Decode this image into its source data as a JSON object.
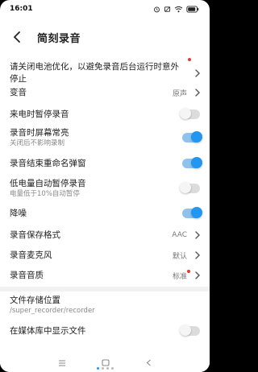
{
  "status_bar": {
    "time": "16:01"
  },
  "header": {
    "title": "简刻录音"
  },
  "settings": [
    {
      "label": "请关闭电池优化，以避免录音后台运行时意外停止"
    },
    {
      "label": "变音",
      "value": "原声"
    },
    {
      "label": "来电时暂停录音",
      "toggle": "off"
    },
    {
      "label": "录音时屏幕常亮",
      "sub": "关闭后不影响录制",
      "toggle": "on"
    },
    {
      "label": "录音结束重命名弹窗",
      "toggle": "on"
    },
    {
      "label": "低电量自动暂停录音",
      "sub": "电量低于10%自动暂停",
      "toggle": "off"
    },
    {
      "label": "降噪",
      "toggle": "on"
    },
    {
      "label": "录音保存格式",
      "value": "AAC"
    },
    {
      "label": "录音麦克风",
      "value": "默认"
    },
    {
      "label": "录音音质",
      "value": "标准"
    },
    {
      "label": "文件存储位置",
      "sub": "/super_recorder/recorder"
    },
    {
      "label": "在媒体库中显示文件",
      "toggle": "off"
    }
  ],
  "colors": {
    "accent": "#2196f3",
    "alert_dot": "#e53935"
  },
  "icons": [
    "back-arrow-icon",
    "chevron-right-icon",
    "menu-icon",
    "home-icon",
    "back-icon"
  ]
}
